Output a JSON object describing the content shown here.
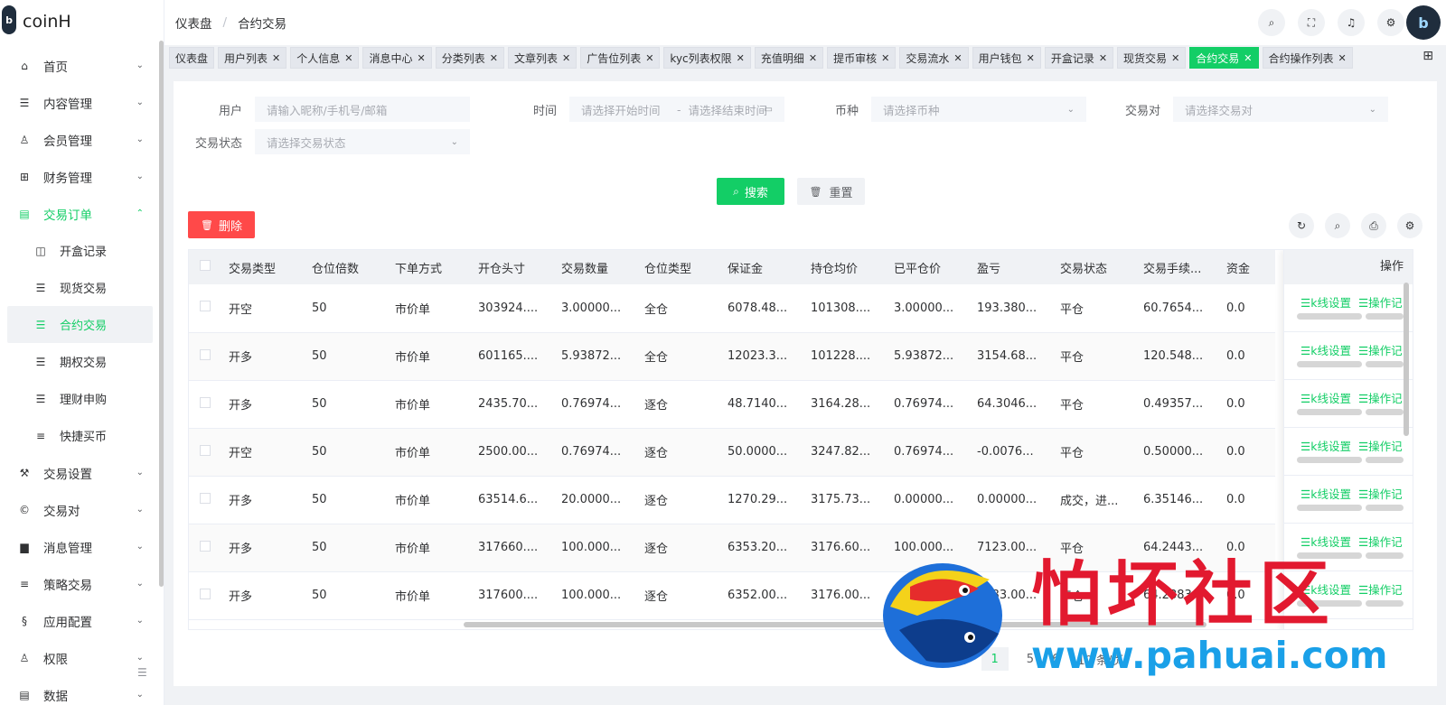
{
  "app": {
    "logo_text": "coinH",
    "logo_badge": "b",
    "avatar_text": "b"
  },
  "sidebar": {
    "items": [
      {
        "label": "首页",
        "icon": "home-icon",
        "glyph": "⌂",
        "chev": "⌄"
      },
      {
        "label": "内容管理",
        "icon": "list-icon",
        "glyph": "☰",
        "chev": "⌄"
      },
      {
        "label": "会员管理",
        "icon": "user-icon",
        "glyph": "♙",
        "chev": "⌄"
      },
      {
        "label": "财务管理",
        "icon": "table-icon",
        "glyph": "⊞",
        "chev": "⌄"
      },
      {
        "label": "交易订单",
        "icon": "order-icon",
        "glyph": "▤",
        "chev": "⌃"
      }
    ],
    "sub_items": [
      {
        "label": "开盒记录",
        "glyph": "◫"
      },
      {
        "label": "现货交易",
        "glyph": "☰"
      },
      {
        "label": "合约交易",
        "glyph": "☰"
      },
      {
        "label": "期权交易",
        "glyph": "☰"
      },
      {
        "label": "理财申购",
        "glyph": "☰"
      },
      {
        "label": "快捷买币",
        "glyph": "≡"
      }
    ],
    "items_after": [
      {
        "label": "交易设置",
        "icon": "wrench-icon",
        "glyph": "⚒",
        "chev": "⌄"
      },
      {
        "label": "交易对",
        "icon": "copyright-icon",
        "glyph": "©",
        "chev": "⌄"
      },
      {
        "label": "消息管理",
        "icon": "message-icon",
        "glyph": "▆",
        "chev": "⌄"
      },
      {
        "label": "策略交易",
        "icon": "menu-icon",
        "glyph": "≡",
        "chev": "⌄"
      },
      {
        "label": "应用配置",
        "icon": "config-icon",
        "glyph": "§",
        "chev": "⌄"
      },
      {
        "label": "权限",
        "icon": "permission-icon",
        "glyph": "♙",
        "chev": "⌄"
      },
      {
        "label": "数据",
        "icon": "data-icon",
        "glyph": "▤",
        "chev": "⌄"
      }
    ]
  },
  "breadcrumb": {
    "home": "仪表盘",
    "sep": "/",
    "current": "合约交易"
  },
  "header_icons": {
    "search": "⌕",
    "fullscreen": "⛶",
    "bell": "♫",
    "settings": "⚙"
  },
  "tags": [
    {
      "label": "仪表盘",
      "closable": false
    },
    {
      "label": "用户列表",
      "closable": true
    },
    {
      "label": "个人信息",
      "closable": true
    },
    {
      "label": "消息中心",
      "closable": true
    },
    {
      "label": "分类列表",
      "closable": true
    },
    {
      "label": "文章列表",
      "closable": true
    },
    {
      "label": "广告位列表",
      "closable": true
    },
    {
      "label": "kyc列表权限",
      "closable": true
    },
    {
      "label": "充值明细",
      "closable": true
    },
    {
      "label": "提币审核",
      "closable": true
    },
    {
      "label": "交易流水",
      "closable": true
    },
    {
      "label": "用户钱包",
      "closable": true
    },
    {
      "label": "开盒记录",
      "closable": true
    },
    {
      "label": "现货交易",
      "closable": true
    },
    {
      "label": "合约交易",
      "closable": true,
      "active": true
    },
    {
      "label": "合约操作列表",
      "closable": true
    }
  ],
  "tag_close": "✕",
  "tags_more": "⊞",
  "filters": {
    "user_label": "用户",
    "user_placeholder": "请输入昵称/手机号/邮箱",
    "time_label": "时间",
    "time_start": "请选择开始时间",
    "time_sep": "-",
    "time_end": "请选择结束时间",
    "coin_label": "币种",
    "coin_placeholder": "请选择币种",
    "pair_label": "交易对",
    "pair_placeholder": "请选择交易对",
    "status_label": "交易状态",
    "status_placeholder": "请选择交易状态",
    "caret": "⌄",
    "calendar": "📅"
  },
  "buttons": {
    "search": "搜索",
    "search_icon": "⌕",
    "reset": "重置",
    "reset_icon": "🗑",
    "delete": "删除",
    "delete_icon": "🗑"
  },
  "tool_icons": {
    "refresh": "↻",
    "search": "⌕",
    "print": "⎙",
    "settings": "⚙"
  },
  "table": {
    "columns": [
      "交易类型",
      "仓位倍数",
      "下单方式",
      "开仓头寸",
      "交易数量",
      "仓位类型",
      "保证金",
      "持仓均价",
      "已平仓价",
      "盈亏",
      "交易状态",
      "交易手续...",
      "资金"
    ],
    "ops_header": "操作",
    "rows": [
      [
        "开空",
        "50",
        "市价单",
        "303924....",
        "3.00000...",
        "全仓",
        "6078.48...",
        "101308....",
        "3.00000...",
        "193.380...",
        "平仓",
        "60.7654...",
        "0.0"
      ],
      [
        "开多",
        "50",
        "市价单",
        "601165....",
        "5.93872...",
        "全仓",
        "12023.3...",
        "101228....",
        "5.93872...",
        "3154.68...",
        "平仓",
        "120.548...",
        "0.0"
      ],
      [
        "开多",
        "50",
        "市价单",
        "2435.70...",
        "0.76974...",
        "逐仓",
        "48.7140...",
        "3164.28...",
        "0.76974...",
        "64.3046...",
        "平仓",
        "0.49357...",
        "0.0"
      ],
      [
        "开空",
        "50",
        "市价单",
        "2500.00...",
        "0.76974...",
        "逐仓",
        "50.0000...",
        "3247.82...",
        "0.76974...",
        "-0.0076...",
        "平仓",
        "0.50000...",
        "0.0"
      ],
      [
        "开多",
        "50",
        "市价单",
        "63514.6...",
        "20.0000...",
        "逐仓",
        "1270.29...",
        "3175.73...",
        "0.00000...",
        "0.00000...",
        "成交，进...",
        "6.35146...",
        "0.0"
      ],
      [
        "开多",
        "50",
        "市价单",
        "317660....",
        "100.000...",
        "逐仓",
        "6353.20...",
        "3176.60...",
        "100.000...",
        "7123.00...",
        "平仓",
        "64.2443...",
        "0.0"
      ],
      [
        "开多",
        "50",
        "市价单",
        "317600....",
        "100.000...",
        "逐仓",
        "6352.00...",
        "3176.00...",
        "100.000...",
        "7183.00...",
        "平仓",
        "64.2383...",
        "0.0"
      ]
    ],
    "op_kline": "☰k线设置",
    "op_action": "☰操作记"
  },
  "pager": {
    "total": "24 条",
    "page1": "1",
    "page5": "5",
    "page6": "6",
    "size": "10 条/页"
  },
  "watermark": {
    "cn": "怕坏社区",
    "url": "www.pahuai.com"
  }
}
